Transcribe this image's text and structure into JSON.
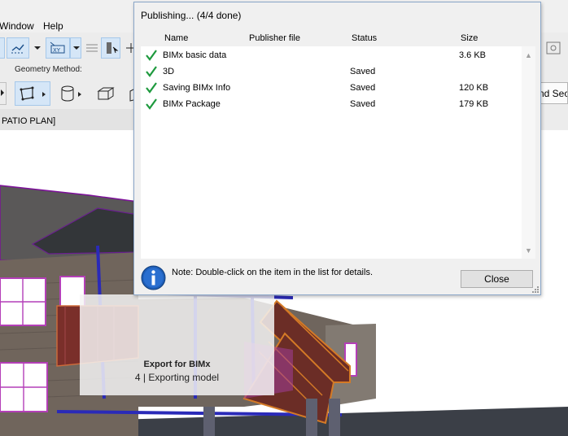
{
  "app": {
    "menu": {
      "window": "Window",
      "help": "Help"
    },
    "toolbar": {
      "geometry_method_label": "Geometry Method:"
    },
    "view_title": "PATIO PLAN]",
    "right_button_label": "nd Sec",
    "icons": [
      "snap-icon",
      "guide-icon",
      "coordinate-icon",
      "hatch-icon",
      "selection-icon",
      "move-icon",
      "polygon-icon",
      "cylinder-icon",
      "box-icon",
      "rotated-box-icon",
      "settings-icon"
    ]
  },
  "progress": {
    "title": "Export for BIMx",
    "status": "4 | Exporting model"
  },
  "dialog": {
    "title": "Publishing... (4/4 done)",
    "columns": {
      "name": "Name",
      "publisher_file": "Publisher file",
      "status": "Status",
      "size": "Size"
    },
    "rows": [
      {
        "name": "BIMx basic data",
        "publisher_file": "",
        "status": "",
        "size": "3.6 KB"
      },
      {
        "name": "3D",
        "publisher_file": "",
        "status": "Saved",
        "size": ""
      },
      {
        "name": "Saving BIMx Info",
        "publisher_file": "",
        "status": "Saved",
        "size": "120 KB"
      },
      {
        "name": "BIMx Package",
        "publisher_file": "",
        "status": "Saved",
        "size": "179 KB"
      }
    ],
    "note": "Note: Double-click on the item in the list for details.",
    "close_label": "Close",
    "colors": {
      "check": "#1e9a3e",
      "info": "#1f5fb8",
      "dialog_border": "#8aa6c8"
    }
  }
}
